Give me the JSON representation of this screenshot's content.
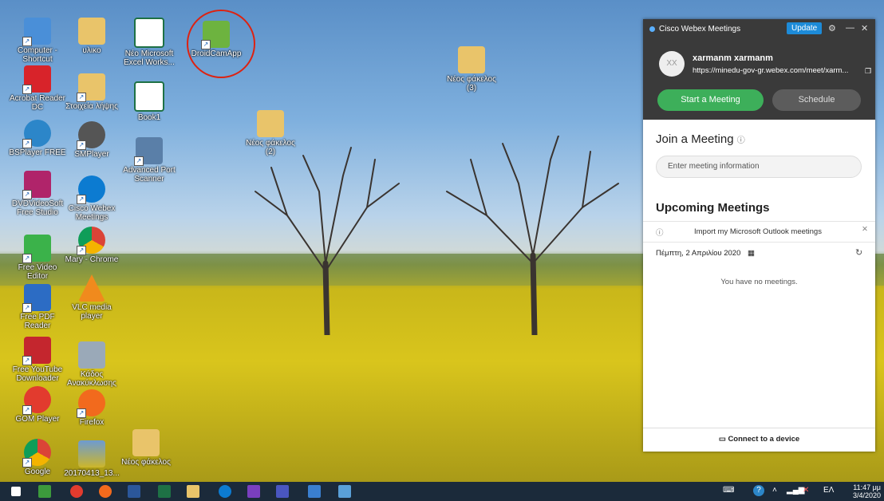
{
  "desktop_icons": [
    {
      "label": "Computer - Shortcut",
      "icon": "computer-icon",
      "color": "#4a8fd8"
    },
    {
      "label": "Acrobat Reader DC",
      "icon": "acrobat-icon",
      "color": "#d8232a"
    },
    {
      "label": "BSPlayer FREE",
      "icon": "bsplayer-icon",
      "color": "#2c86c9"
    },
    {
      "label": "DVDVideoSoft Free Studio",
      "icon": "dvdvideosoft-icon",
      "color": "#b0246a"
    },
    {
      "label": "Free Video Editor",
      "icon": "video-editor-icon",
      "color": "#3bb24a"
    },
    {
      "label": "Free PDF Reader",
      "icon": "pdf-reader-icon",
      "color": "#2c6cc4"
    },
    {
      "label": "Free YouTube Downloader",
      "icon": "youtube-downloader-icon",
      "color": "#c4262e"
    },
    {
      "label": "GOM Player",
      "icon": "gom-player-icon",
      "color": "#e23b2e"
    },
    {
      "label": "Google",
      "icon": "chrome-icon",
      "color": "#e8b21a"
    },
    {
      "label": "υλικο",
      "icon": "folder-icon",
      "color": "#e9c46a"
    },
    {
      "label": "Στοιχεία λήψης",
      "icon": "downloads-folder-icon",
      "color": "#e9c46a"
    },
    {
      "label": "SMPlayer",
      "icon": "smplayer-icon",
      "color": "#555555"
    },
    {
      "label": "Cisco Webex Meetings",
      "icon": "webex-icon",
      "color": "#0c7bd1"
    },
    {
      "label": "Mary - Chrome",
      "icon": "chrome-icon",
      "color": "#4285f4"
    },
    {
      "label": "VLC media player",
      "icon": "vlc-icon",
      "color": "#f08a1d"
    },
    {
      "label": "Κάδος Ανακύκλωσης",
      "icon": "recycle-bin-icon",
      "color": "#9aa9b8"
    },
    {
      "label": "Firefox",
      "icon": "firefox-icon",
      "color": "#f26a1d"
    },
    {
      "label": "20170413_13...",
      "icon": "image-file-icon",
      "color": "#6d9bd1"
    },
    {
      "label": "Νέο Microsoft Excel Works...",
      "icon": "excel-icon",
      "color": "#1e7145"
    },
    {
      "label": "Book1",
      "icon": "excel-icon",
      "color": "#1e7145"
    },
    {
      "label": "Advanced Port Scanner",
      "icon": "port-scanner-icon",
      "color": "#5a7fa8"
    },
    {
      "label": "Νέος φάκελος",
      "icon": "folder-icon",
      "color": "#e9c46a"
    },
    {
      "label": "DroidCamApp",
      "icon": "droidcam-icon",
      "color": "#6db33f"
    },
    {
      "label": "Νέος φάκελος (2)",
      "icon": "folder-icon",
      "color": "#e9c46a"
    },
    {
      "label": "Νέος φάκελος (3)",
      "icon": "folder-icon",
      "color": "#e9c46a"
    }
  ],
  "webex": {
    "title": "Cisco Webex Meetings",
    "update_label": "Update",
    "avatar_initials": "XX",
    "user_name": "xarmanm xarmanm",
    "url": "https://minedu-gov-gr.webex.com/meet/xarm...",
    "start_label": "Start a Meeting",
    "schedule_label": "Schedule",
    "join_heading": "Join a Meeting",
    "join_placeholder": "Enter meeting information",
    "upcoming_heading": "Upcoming Meetings",
    "outlook_text": "Import my Microsoft Outlook meetings",
    "date_text": "Πέμπτη, 2 Απριλίου 2020",
    "no_meetings": "You have no meetings.",
    "connect_label": "Connect to a device",
    "accent_green": "#3daf5a"
  },
  "taskbar": {
    "apps": [
      {
        "icon": "windows-start-icon",
        "color": "#ffffff"
      },
      {
        "icon": "task-view-icon",
        "color": "#3c9a3c"
      },
      {
        "icon": "gom-player-icon",
        "color": "#e23b2e"
      },
      {
        "icon": "firefox-icon",
        "color": "#f26a1d"
      },
      {
        "icon": "word-icon",
        "color": "#2b579a"
      },
      {
        "icon": "excel-icon",
        "color": "#1e7145"
      },
      {
        "icon": "file-explorer-icon",
        "color": "#e9c46a"
      },
      {
        "icon": "webex-icon",
        "color": "#0c7bd1"
      },
      {
        "icon": "search-app-icon",
        "color": "#7a3fbf"
      },
      {
        "icon": "settings-icon",
        "color": "#4a56c0"
      },
      {
        "icon": "photo-viewer-icon",
        "color": "#3a7fd0"
      },
      {
        "icon": "snipping-icon",
        "color": "#5aa0d8"
      }
    ],
    "language": "ΕΛ",
    "time": "11:47 μμ",
    "date": "3/4/2020"
  }
}
